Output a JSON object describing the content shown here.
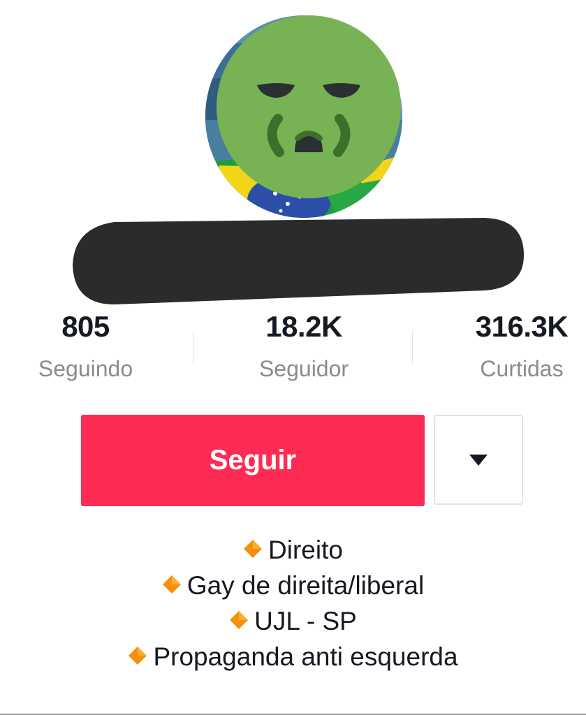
{
  "profile": {
    "avatar_icon": "nauseated-face-icon"
  },
  "stats": {
    "following": {
      "value": "805",
      "label": "Seguindo"
    },
    "followers": {
      "value": "18.2K",
      "label": "Seguidor"
    },
    "likes": {
      "value": "316.3K",
      "label": "Curtidas"
    }
  },
  "actions": {
    "follow_label": "Seguir",
    "dropdown_icon": "caret-down-icon"
  },
  "bio": {
    "bullet_icon": "orange-diamond-icon",
    "lines": [
      "Direito",
      "Gay de direita/liberal",
      "UJL - SP",
      "Propaganda anti esquerda"
    ]
  },
  "colors": {
    "follow_button": "#fe2c55",
    "secondary_text": "#8a8b91",
    "redaction": "#2a2b2d",
    "emoji_green": "#77b255"
  }
}
